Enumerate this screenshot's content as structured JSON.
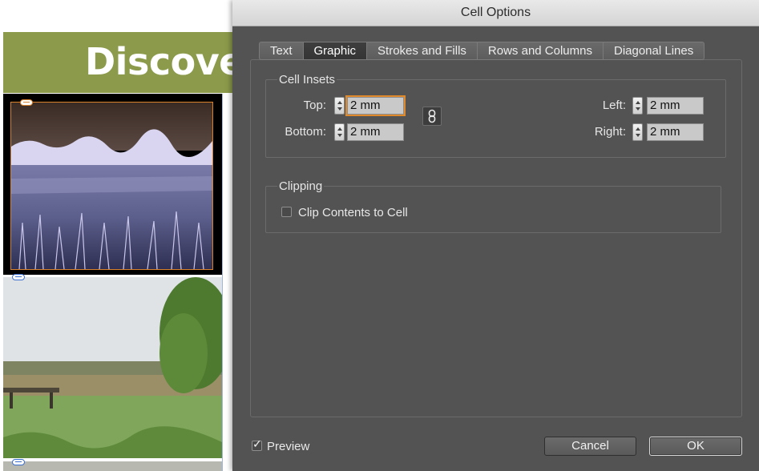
{
  "document": {
    "header_title": "Discover"
  },
  "dialog": {
    "title": "Cell Options",
    "tabs": [
      {
        "label": "Text",
        "active": false
      },
      {
        "label": "Graphic",
        "active": true
      },
      {
        "label": "Strokes and Fills",
        "active": false
      },
      {
        "label": "Rows and Columns",
        "active": false
      },
      {
        "label": "Diagonal Lines",
        "active": false
      }
    ],
    "cell_insets": {
      "group_label": "Cell Insets",
      "top": {
        "label": "Top:",
        "value": "2 mm"
      },
      "bottom": {
        "label": "Bottom:",
        "value": "2 mm"
      },
      "left": {
        "label": "Left:",
        "value": "2 mm"
      },
      "right": {
        "label": "Right:",
        "value": "2 mm"
      },
      "link_icon": "chain-link-icon"
    },
    "clipping": {
      "group_label": "Clipping",
      "clip_contents_label": "Clip Contents to Cell",
      "clip_contents_checked": false
    },
    "preview": {
      "label": "Preview",
      "checked": true
    },
    "cancel_label": "Cancel",
    "ok_label": "OK"
  },
  "colors": {
    "dialog_bg": "#535353",
    "header_green": "#8b9a4b",
    "focus_orange": "#e08a2c"
  }
}
